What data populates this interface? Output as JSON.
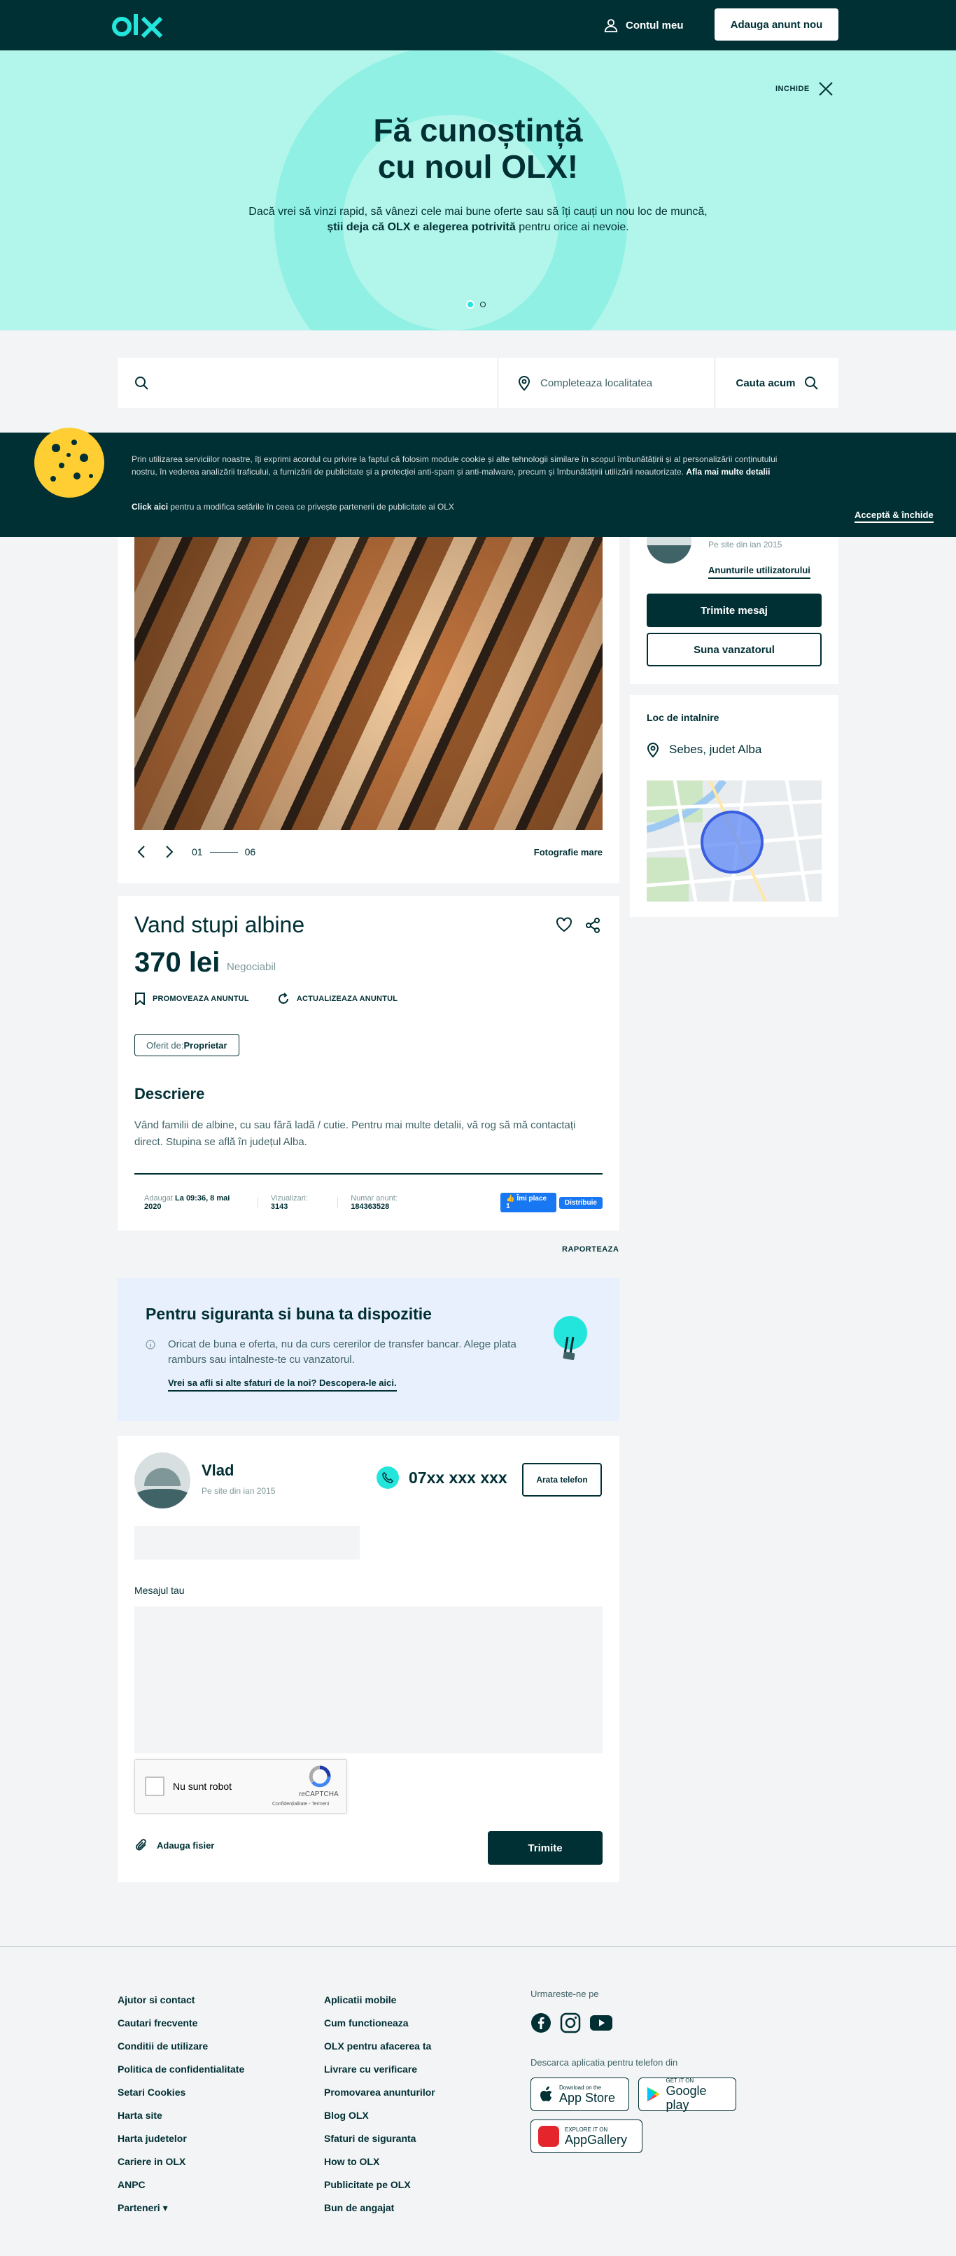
{
  "header": {
    "logo_text": "olx",
    "account_label": "Contul meu",
    "post_ad_label": "Adauga anunt nou"
  },
  "hero": {
    "title_line1": "Fă cunoștință",
    "title_line2": "cu noul OLX!",
    "text_plain1": "Dacă vrei să vinzi rapid, să vânezi cele mai bune oferte sau să îți cauți un nou loc de muncă, ",
    "text_bold": "știi deja că OLX e alegerea potrivită",
    "text_plain2": " pentru orice ai nevoie.",
    "close_label": "INCHIDE",
    "slides_total": 2,
    "slide_active": 1
  },
  "search": {
    "placeholder": "",
    "location_placeholder": "Completeaza localitatea",
    "button_label": "Cauta acum"
  },
  "cookie": {
    "text": "Prin utilizarea serviciilor noastre, îți exprimi acordul cu privire la faptul că folosim module cookie și alte tehnologii similare în scopul îmbunătățirii și al personalizării conținutului nostru, în vederea analizării traficului, a furnizării de publicitate și a protecției anti-spam și anti-malware, precum și îmbunătățirii utilizării neautorizate.",
    "more_link": "Afla mai multe detalii",
    "click_here": "Click aici",
    "settings_text": " pentru a modifica setările în ceea ce privește partenerii de publicitate ai OLX",
    "accept_label": "Acceptă & închide"
  },
  "gallery": {
    "counter_current": "01",
    "counter_total": "06",
    "large_photo_label": "Fotografie mare"
  },
  "seller_side": {
    "since": "Pe site din ian 2015",
    "ads_link": "Anunturile utilizatorului",
    "message_label": "Trimite mesaj",
    "call_label": "Suna vanzatorul"
  },
  "meeting": {
    "title": "Loc de intalnire",
    "location": "Sebes, judet Alba"
  },
  "ad": {
    "title": "Vand stupi albine",
    "price": "370 lei",
    "negotiable": "Negociabil",
    "promote_label": "PROMOVEAZA ANUNTUL",
    "refresh_label": "ACTUALIZEAZA ANUNTUL",
    "offered_by_label": "Oferit de: ",
    "offered_by_value": "Proprietar",
    "description_title": "Descriere",
    "description": "Vând familii de albine, cu sau fără ladă / cutie. Pentru mai multe detalii, vă rog să mă contactați direct. Stupina se află în județul Alba.",
    "added_label": "Adaugat ",
    "added_value": "La 09:36, 8 mai 2020",
    "views_label": "Vizualizari: ",
    "views_value": "3143",
    "ad_number_label": "Numar anunt: ",
    "ad_number_value": "184363528",
    "like_label": "Îmi place 1",
    "share_label": "Distribuie"
  },
  "report_label": "RAPORTEAZA",
  "safety": {
    "title": "Pentru siguranta si buna ta dispozitie",
    "text": "Oricat de buna e oferta, nu da curs cererilor de transfer bancar. Alege plata ramburs sau intalneste-te cu vanzatorul.",
    "link": "Vrei sa afli si alte sfaturi de la noi? Descopera-le aici."
  },
  "contact": {
    "seller_name": "Vlad",
    "since": "Pe site din ian 2015",
    "phone": "07xx xxx xxx",
    "show_phone_label": "Arata telefon",
    "message_label": "Mesajul tau",
    "captcha_label": "Nu sunt robot",
    "captcha_brand": "reCAPTCHA",
    "captcha_terms": "Confidențialitate - Termeni",
    "attach_label": "Adauga fisier",
    "send_label": "Trimite"
  },
  "footer": {
    "col1": [
      "Ajutor si contact",
      "Cautari frecvente",
      "Conditii de utilizare",
      "Politica de confidentialitate",
      "Setari Cookies",
      "Harta site",
      "Harta judetelor",
      "Cariere in OLX",
      "ANPC",
      "Parteneri ▾"
    ],
    "col2": [
      "Aplicatii mobile",
      "Cum functioneaza",
      "OLX pentru afacerea ta",
      "Livrare cu verificare",
      "Promovarea anunturilor",
      "Blog OLX",
      "Sfaturi de siguranta",
      "How to OLX",
      "Publicitate pe OLX",
      "Bun de angajat"
    ],
    "follow_label": "Urmareste-ne pe",
    "apps_label": "Descarca aplicatia pentru telefon din",
    "appstore_small": "Download on the",
    "appstore_big": "App Store",
    "gplay_small": "GET IT ON",
    "gplay_big": "Google play",
    "appgallery_small": "EXPLORE IT ON",
    "appgallery_big": "AppGallery"
  },
  "colors": {
    "brand_dark": "#002f34",
    "brand_teal": "#23e5db",
    "hero_bg": "#b2f5ea"
  }
}
